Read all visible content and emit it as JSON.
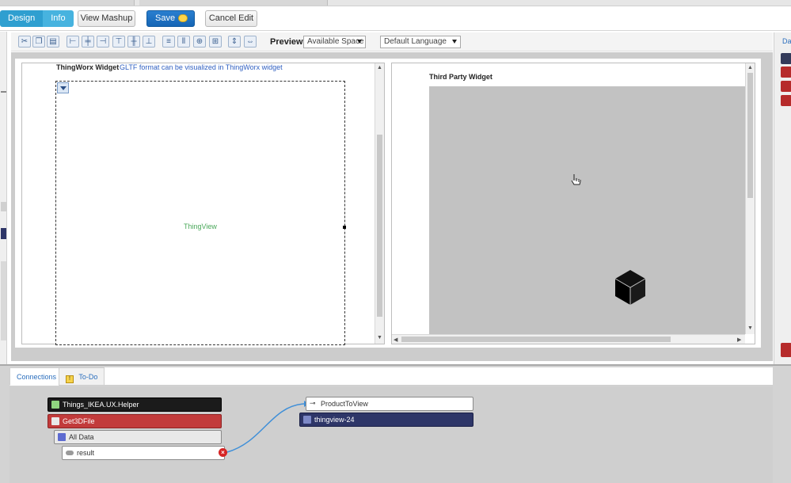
{
  "toolbar": {
    "design_label": "Design",
    "info_label": "Info",
    "view_mashup_label": "View Mashup",
    "save_label": "Save",
    "cancel_edit_label": "Cancel Edit"
  },
  "layout_toolbar": {
    "tools": [
      "cut-icon",
      "copy-icon",
      "paste-icon",
      "align-left-icon",
      "align-center-icon",
      "align-right-icon",
      "align-top-icon",
      "align-middle-icon",
      "align-bottom-icon",
      "distribute-h-icon",
      "distribute-v-icon",
      "center-icon",
      "grid-icon",
      "same-height-icon",
      "same-width-icon"
    ],
    "preview_label": "Preview",
    "space_select": "Available Space",
    "language_select": "Default Language"
  },
  "left_panel": {
    "title": "ThingWorx Widget",
    "subtitle": "GLTF format can be visualized in ThingWorx widget",
    "widget_label": "ThingView"
  },
  "right_panel": {
    "title": "Third Party Widget"
  },
  "right_sidebar": {
    "tab_label": "Da"
  },
  "bottom": {
    "tabs": [
      {
        "label": "Connections"
      },
      {
        "label": "To-Do"
      }
    ],
    "nodes": {
      "thing": "Things_IKEA.UX.Helper",
      "service": "Get3DFile",
      "all_data": "All Data",
      "result": "result",
      "target_prop": "ProductToView",
      "target_widget": "thingview-24"
    }
  },
  "colors": {
    "accent_blue": "#2f9fd0",
    "save_blue": "#1565b5",
    "service_red": "#c23b3b",
    "widget_navy": "#2e3668",
    "thingview_green": "#4aa85a",
    "link_blue": "#2f5fc1"
  }
}
